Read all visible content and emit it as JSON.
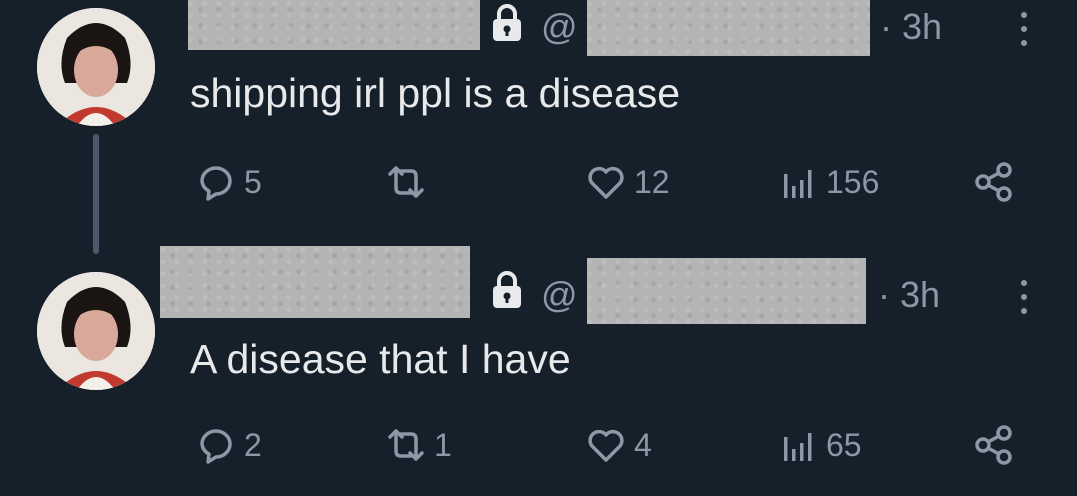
{
  "tweets": [
    {
      "handle_prefix": "@",
      "time": "· 3h",
      "text": "shipping irl ppl is a disease",
      "replies": "5",
      "reposts": "",
      "likes": "12",
      "views": "156"
    },
    {
      "handle_prefix": "@",
      "time": "· 3h",
      "text": "A disease that I have",
      "replies": "2",
      "reposts": "1",
      "likes": "4",
      "views": "65"
    }
  ],
  "icons": {
    "reply": "reply-bubble-icon",
    "repost": "repost-arrows-icon",
    "like": "heart-icon",
    "views": "bar-chart-icon",
    "share": "share-nodes-icon",
    "lock": "lock-icon",
    "more": "vertical-ellipsis-icon"
  },
  "colors": {
    "background": "#15202b",
    "text": "#e7e9ea",
    "muted": "#8b98a5"
  }
}
